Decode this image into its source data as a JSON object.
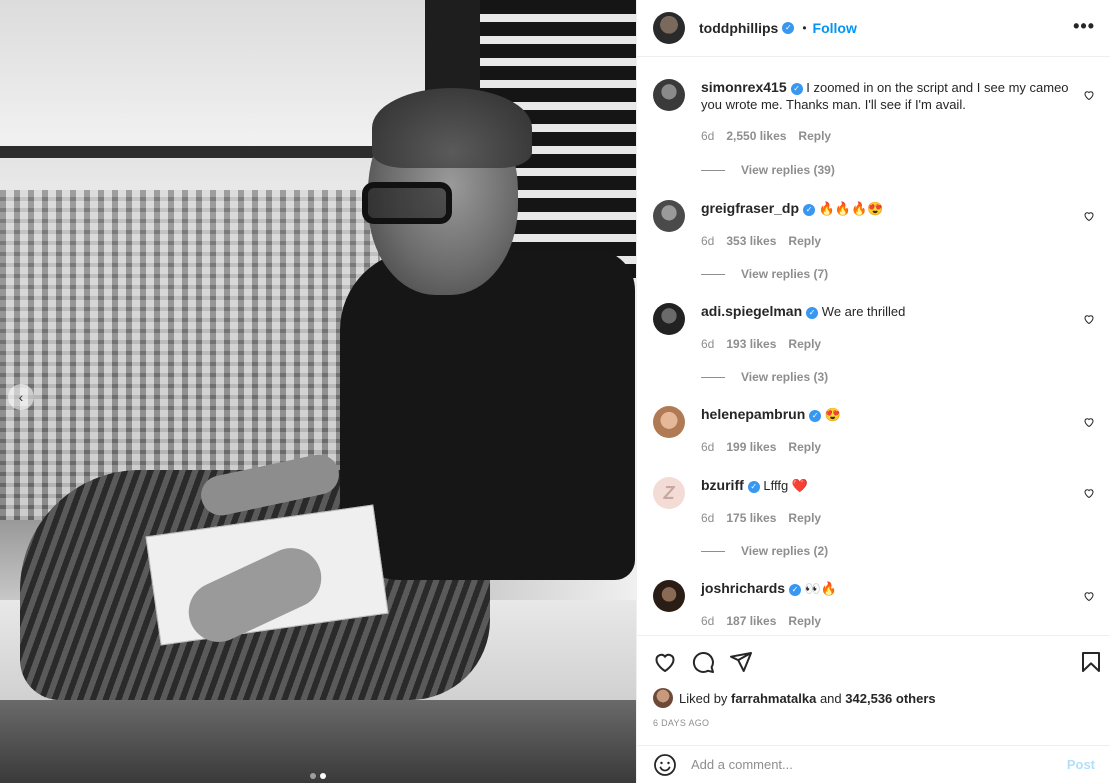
{
  "header": {
    "username": "toddphillips",
    "bullet": "•",
    "follow_label": "Follow",
    "more_label": "•••"
  },
  "photo": {
    "carousel_prev_label": "‹",
    "dots_count": 2,
    "active_dot": 1
  },
  "comments": [
    {
      "username": "simonrex415",
      "verified": true,
      "text": "I zoomed in on the script and I see my cameo you wrote me. Thanks man. I'll see if I'm avail.",
      "age": "6d",
      "likes": "2,550 likes",
      "reply_label": "Reply",
      "view_replies": "View replies (39)"
    },
    {
      "username": "greigfraser_dp",
      "verified": true,
      "text": "🔥🔥🔥😍",
      "age": "6d",
      "likes": "353 likes",
      "reply_label": "Reply",
      "view_replies": "View replies (7)"
    },
    {
      "username": "adi.spiegelman",
      "verified": true,
      "text": "We are thrilled",
      "age": "6d",
      "likes": "193 likes",
      "reply_label": "Reply",
      "view_replies": "View replies (3)"
    },
    {
      "username": "helenepambrun",
      "verified": true,
      "text": "😍",
      "age": "6d",
      "likes": "199 likes",
      "reply_label": "Reply",
      "view_replies": ""
    },
    {
      "username": "bzuriff",
      "verified": true,
      "text": "Lfffg ❤️",
      "age": "6d",
      "likes": "175 likes",
      "reply_label": "Reply",
      "view_replies": "View replies (2)"
    },
    {
      "username": "joshrichards",
      "verified": true,
      "text": "👀🔥",
      "age": "6d",
      "likes": "187 likes",
      "reply_label": "Reply",
      "view_replies": ""
    }
  ],
  "liked_by": {
    "prefix": "Liked by",
    "user": "farrahmatalka",
    "joiner": "and",
    "others": "342,536 others"
  },
  "time_ago": "6 DAYS AGO",
  "add_comment": {
    "placeholder": "Add a comment...",
    "post_label": "Post"
  },
  "colors": {
    "accent": "#0095f6",
    "verified": "#3897f0",
    "muted": "#8e8e8e",
    "post_disabled": "#b2dffc"
  },
  "icons": [
    "verified-badge-icon",
    "more-options-icon",
    "heart-icon",
    "comment-icon",
    "share-icon",
    "bookmark-icon",
    "emoji-icon",
    "chevron-left-icon"
  ]
}
